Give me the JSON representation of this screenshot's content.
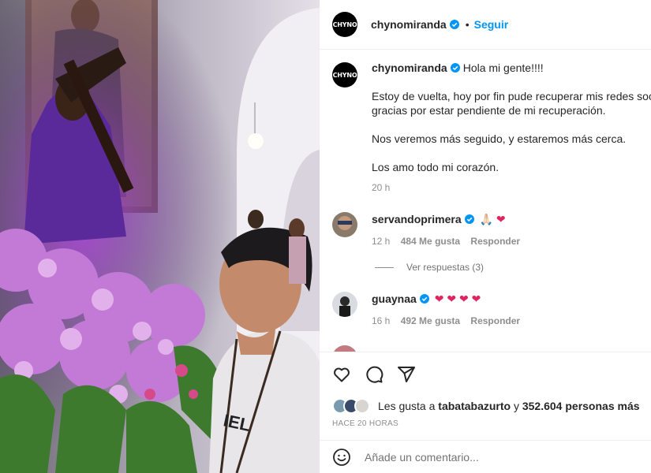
{
  "post": {
    "username": "chynomiranda",
    "follow_label": "Seguir",
    "dot": "•",
    "avatar_text": "CHYNO"
  },
  "caption": {
    "username": "chynomiranda",
    "line1": "Hola mi gente!!!!",
    "para1_line1": "Estoy de vuelta, hoy por fin pude recuperar mis redes soc",
    "para1_line2": "gracias por estar pendiente de mi recuperación.",
    "para2": "Nos veremos más seguido, y estaremos más cerca.",
    "para3": "Los amo todo mi corazón.",
    "time": "20 h"
  },
  "comments": [
    {
      "username": "servandoprimera",
      "emoji": "🙏🏻 ❤",
      "time": "12 h",
      "likes": "484 Me gusta",
      "reply": "Responder"
    },
    {
      "username": "guaynaa",
      "emoji": "❤ ❤ ❤ ❤",
      "time": "16 h",
      "likes": "492 Me gusta",
      "reply": "Responder"
    }
  ],
  "replies_label": "Ver respuestas (3)",
  "likes": {
    "prefix": "Les gusta a ",
    "user": "tabatabazurto",
    "middle": " y ",
    "count": "352.604 personas más"
  },
  "timestamp": "HACE 20 HORAS",
  "comment_input": {
    "placeholder": "Añade un comentario..."
  },
  "colors": {
    "accent": "#0095f6",
    "heart": "#e0245e"
  }
}
